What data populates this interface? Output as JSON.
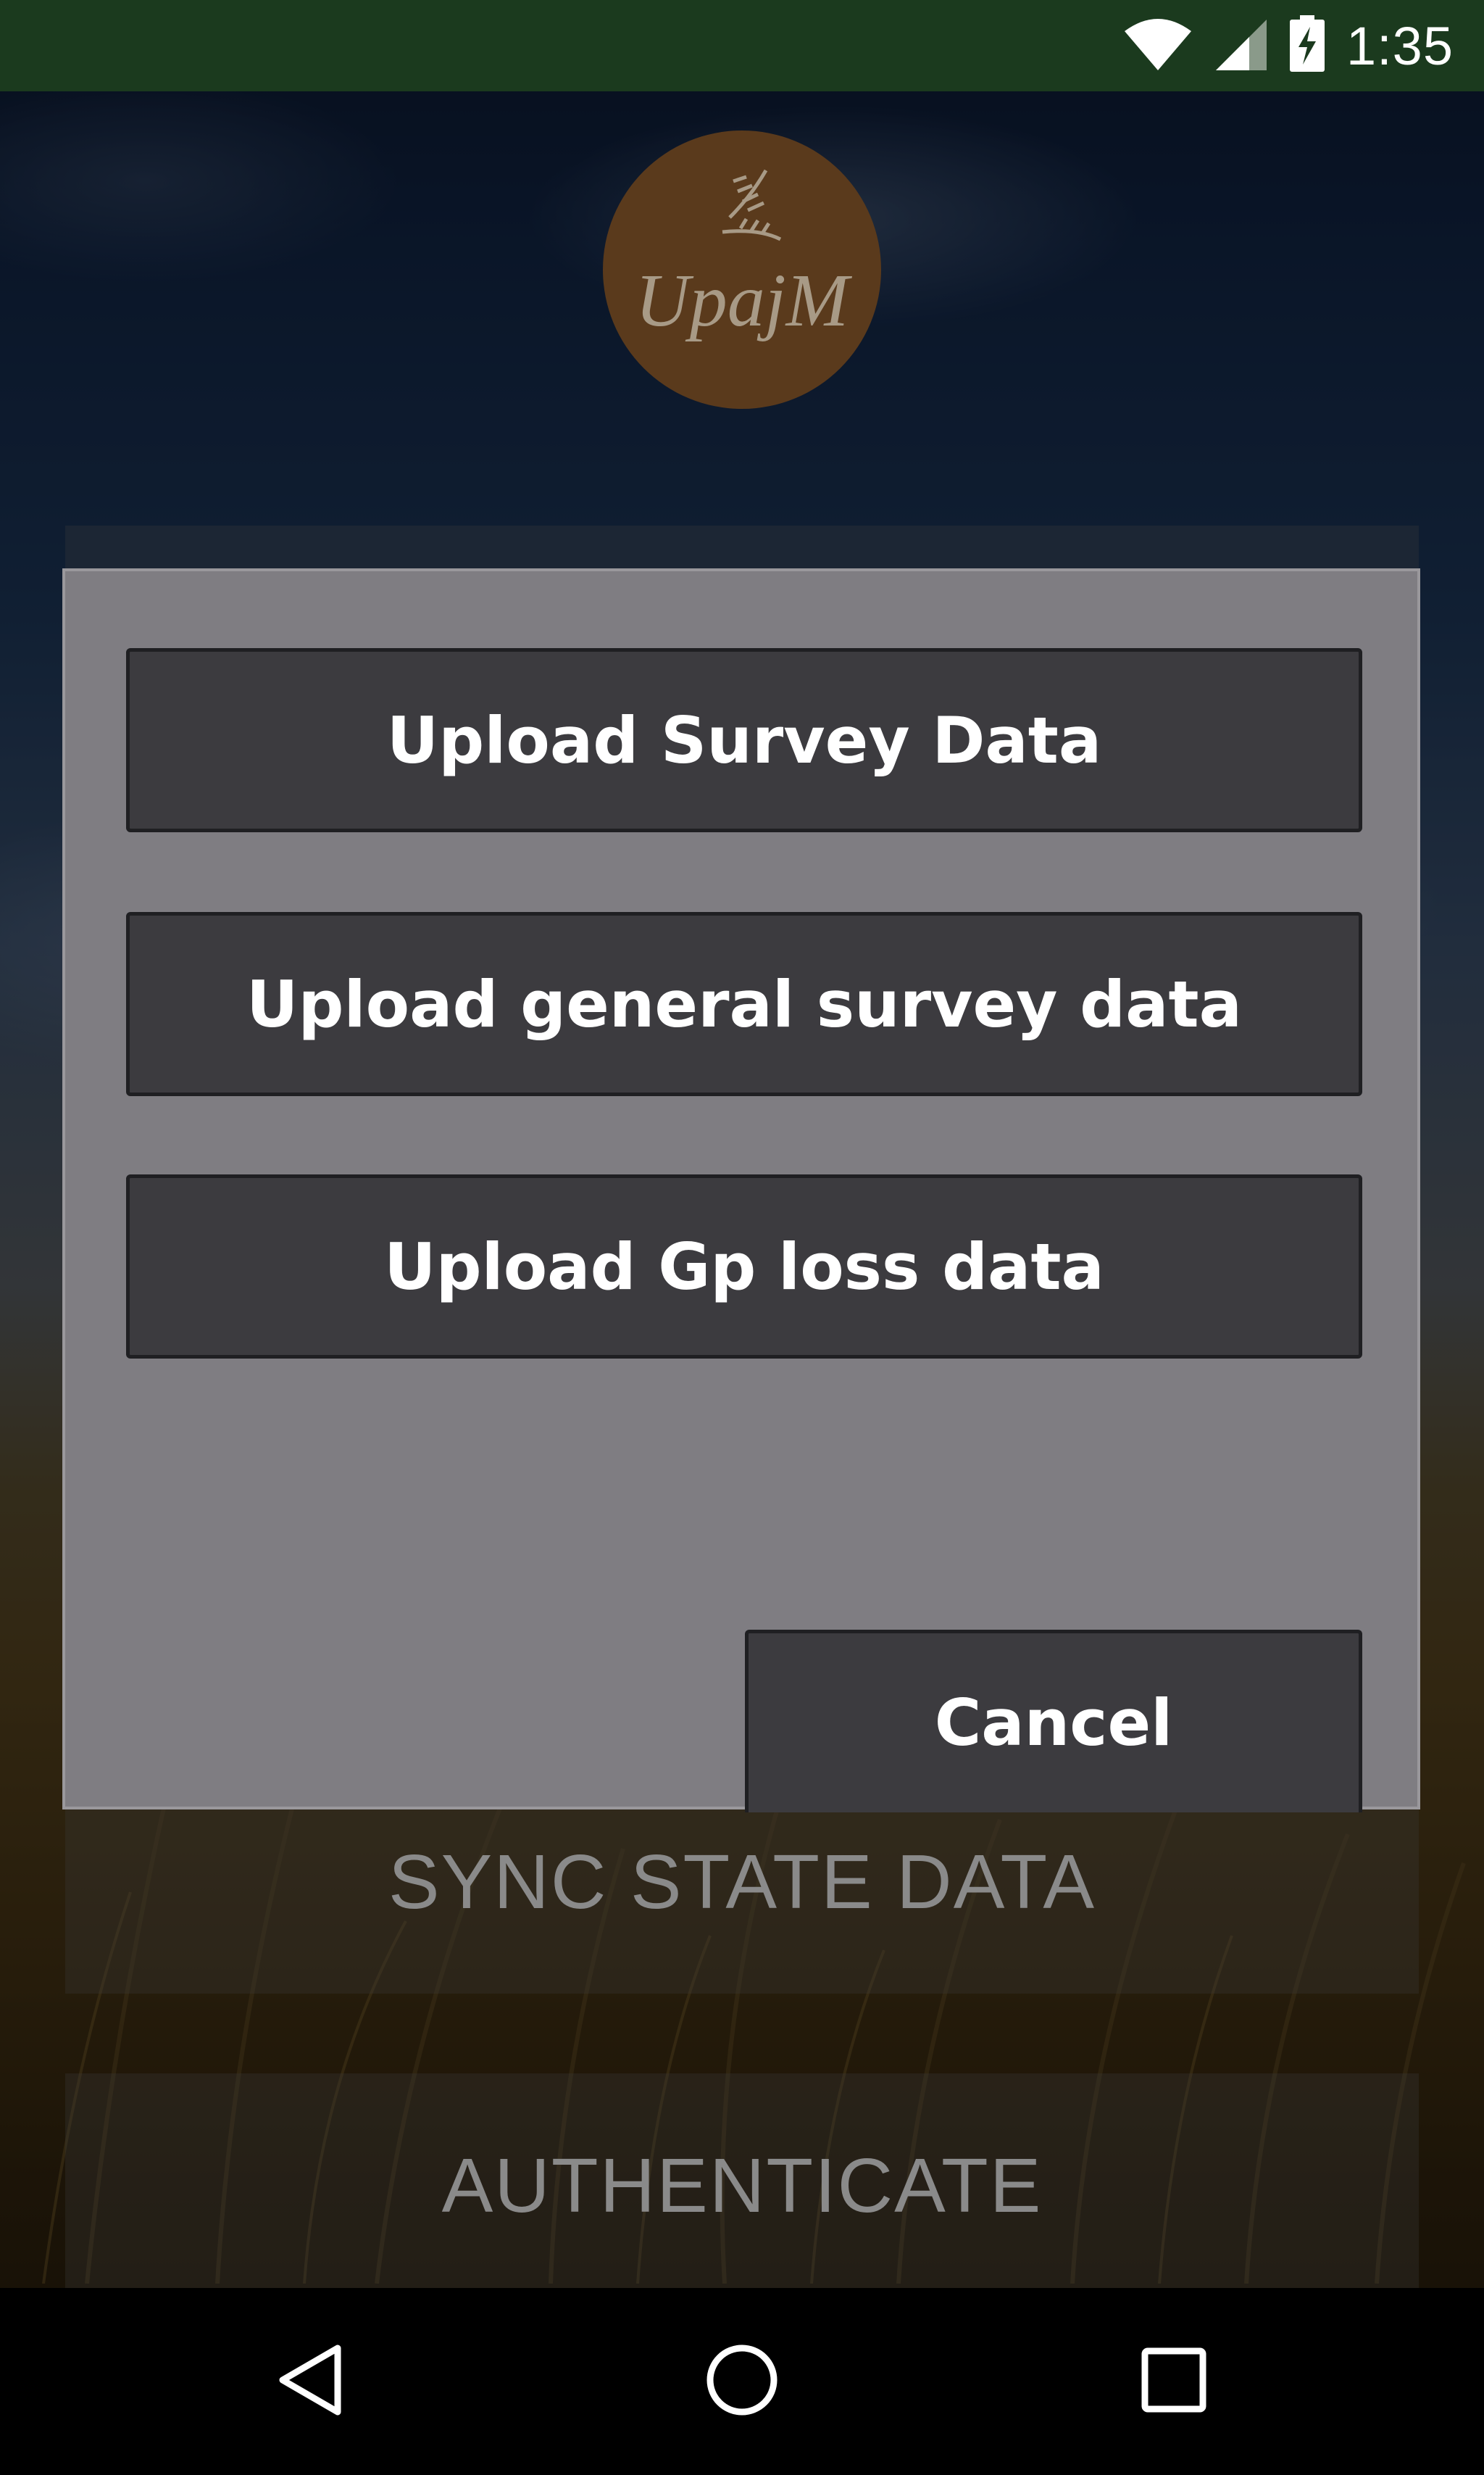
{
  "status_bar": {
    "time": "1:35",
    "icons": [
      "wifi-icon",
      "cell-signal-icon",
      "battery-charging-icon"
    ]
  },
  "logo": {
    "text": "UpajM"
  },
  "page": {
    "buttons": [
      {
        "label": "SYNC STATE DATA"
      },
      {
        "label": "AUTHENTICATE"
      }
    ]
  },
  "dialog": {
    "buttons": [
      {
        "label": "Upload Survey Data"
      },
      {
        "label": "Upload general survey data"
      },
      {
        "label": "Upload Gp loss data"
      }
    ],
    "cancel_label": "Cancel"
  },
  "nav_bar": {
    "icons": [
      "back-icon",
      "home-icon",
      "recents-icon"
    ]
  },
  "colors": {
    "status_bar": "#1b3a1e",
    "dialog_bg": "#7f7d82",
    "dialog_button": "#3c3b3f",
    "logo_bg": "#5a3a1c"
  }
}
